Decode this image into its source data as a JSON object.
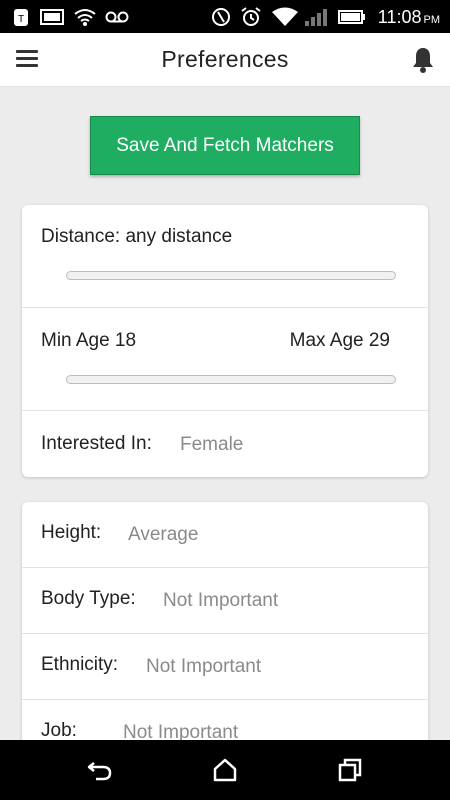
{
  "status_bar": {
    "time": "11:08",
    "ampm": "PM",
    "icons": [
      "carrier-icon",
      "image-icon",
      "wifi-call-icon",
      "voicemail-icon",
      "do-not-disturb-icon",
      "alarm-icon",
      "wifi-icon",
      "signal-icon",
      "battery-icon"
    ]
  },
  "app_bar": {
    "title": "Preferences",
    "menu_icon": "menu-icon",
    "notifications_icon": "bell-icon"
  },
  "save_button": {
    "label": "Save And Fetch Matchers",
    "color": "#1fae61"
  },
  "card1": {
    "distance": {
      "label": "Distance: any distance"
    },
    "age": {
      "min_label": "Min Age 18",
      "max_label": "Max Age 29"
    },
    "interested_in": {
      "label": "Interested In:",
      "value": "Female"
    }
  },
  "card2": {
    "rows": [
      {
        "label": "Height:",
        "value": "Average"
      },
      {
        "label": "Body Type:",
        "value": "Not Important"
      },
      {
        "label": "Ethnicity:",
        "value": "Not Important"
      },
      {
        "label": "Job:",
        "value": "Not Important"
      }
    ]
  },
  "nav_bar": {
    "icons": [
      "back-icon",
      "home-icon",
      "recents-icon"
    ]
  }
}
